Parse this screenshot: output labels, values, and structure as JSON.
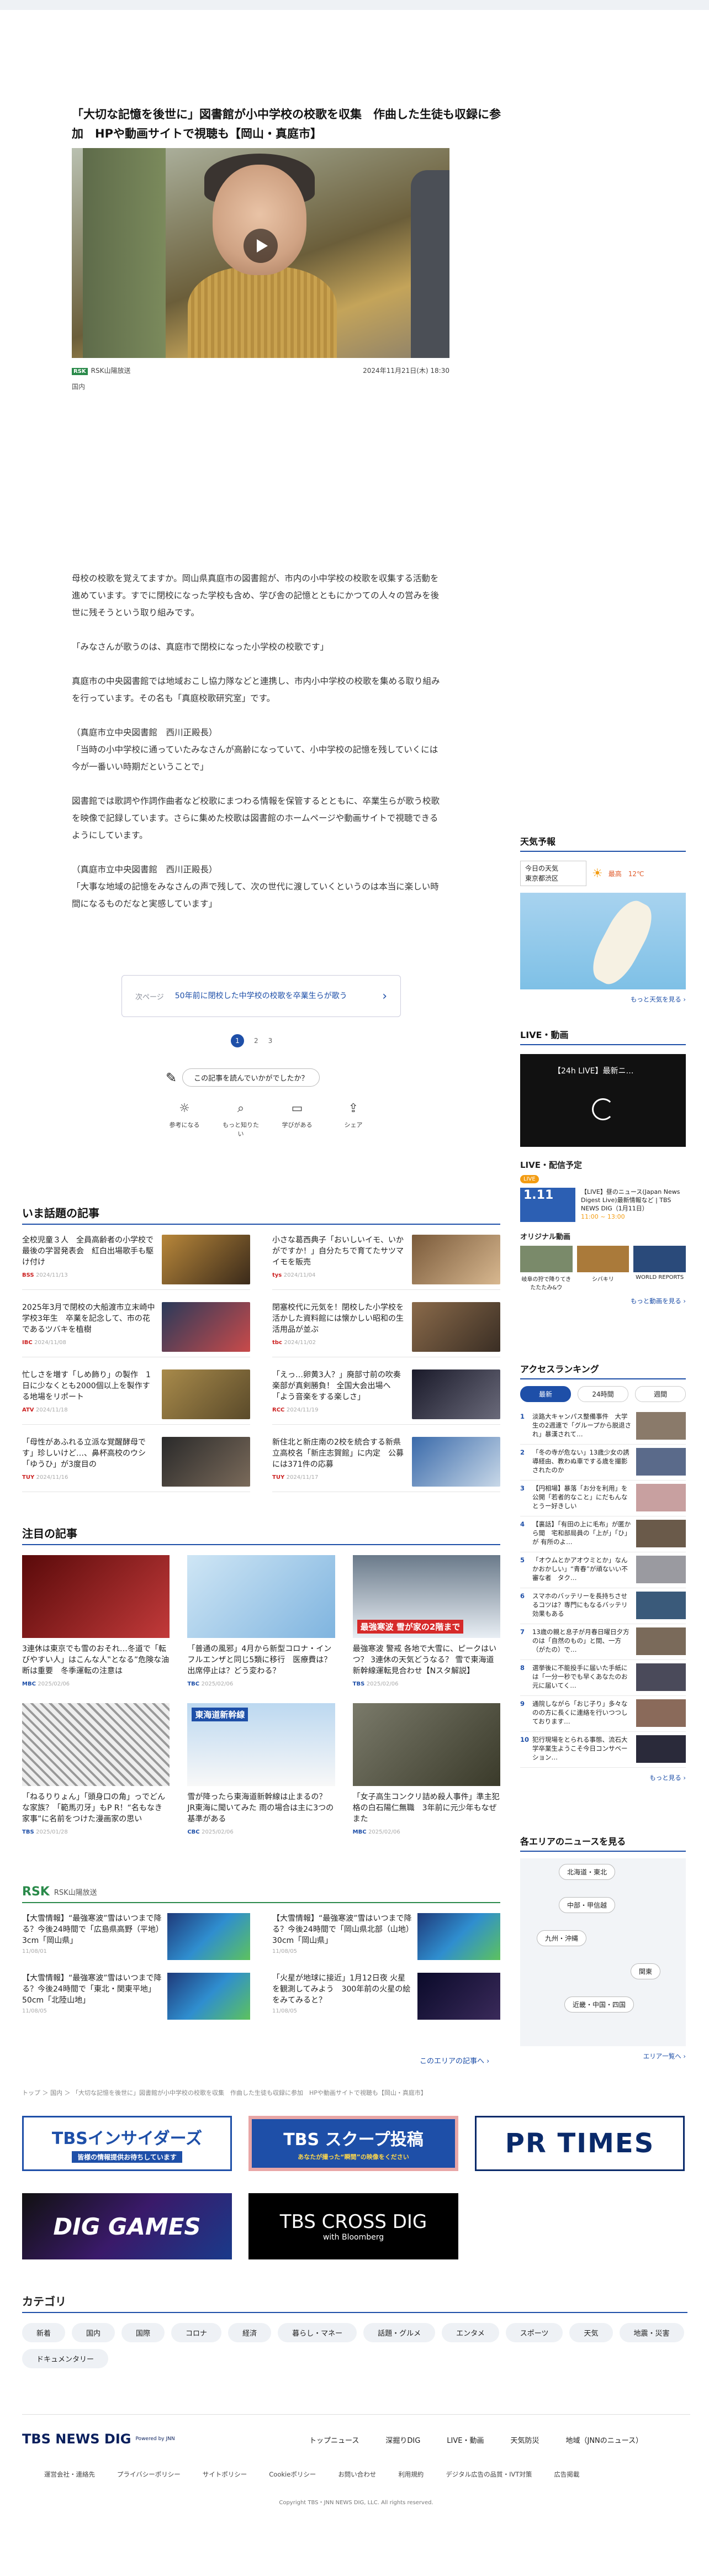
{
  "article": {
    "title": "「大切な記憶を後世に」図書館が小中学校の校歌を収集　作曲した生徒も収録に参加　HPや動画サイトで視聴も【岡山・真庭市】",
    "source": "RSK山陽放送",
    "source_logo": "RSK",
    "date": "2024年11月21日(木) 18:30",
    "category": "国内",
    "paragraphs": [
      "母校の校歌を覚えてますか。岡山県真庭市の図書館が、市内の小中学校の校歌を収集する活動を進めています。すでに閉校になった学校も含め、学び舎の記憶とともにかつての人々の営みを後世に残そうという取り組みです。",
      "「みなさんが歌うのは、真庭市で閉校になった小学校の校歌です」",
      "真庭市の中央図書館では地域おこし協力隊などと連携し、市内小中学校の校歌を集める取り組みを行っています。その名も「真庭校歌研究室」です。",
      "（真庭市立中央図書館　西川正殿長）\n「当時の小中学校に通っていたみなさんが高齢になっていて、小中学校の記憶を残していくには今が一番いい時期だということで」",
      "図書館では歌詞や作詞作曲者など校歌にまつわる情報を保管するとともに、卒業生らが歌う校歌を映像で記録しています。さらに集めた校歌は図書館のホームページや動画サイトで視聴できるようにしています。",
      "（真庭市立中央図書館　西川正殿長）\n「大事な地域の記憶をみなさんの声で残して、次の世代に渡していくというのは本当に楽しい時間になるものだなと実感しています」"
    ],
    "related_label": "次ページ",
    "related_text": "50年前に閉校した中学校の校歌を卒業生らが歌う",
    "pages": [
      "1",
      "2",
      "3"
    ],
    "survey_question": "この記事を読んでいかがでしたか？",
    "reactions": [
      "参考になる",
      "もっと知りたい",
      "学びがある",
      "シェア"
    ]
  },
  "topics": {
    "heading": "いま話題の記事",
    "items": [
      {
        "text": "全校児童３人　全員高齢者の小学校で最後の学習発表会　紅白出場歌手も駆け付け",
        "src": "BSS",
        "date": "2024/11/13"
      },
      {
        "text": "小さな葛西典子「おいしいイモ、いかがですか！」自分たちで育てたサツマイモを販売",
        "src": "tys",
        "date": "2024/11/04"
      },
      {
        "text": "2025年3月で閉校の大船渡市立末崎中学校3年生　卒業を記念して、市の花であるツバキを植樹",
        "src": "IBC",
        "date": "2024/11/08"
      },
      {
        "text": "閉塞校代に元気を！閉校した小学校を活かした資料館には懐かしい昭和の生活用品が並ぶ",
        "src": "tbc",
        "date": "2024/11/02"
      },
      {
        "text": "忙しさを増す「しめ飾り」の製作　1日に少なくとも2000個以上を製作する地場をリポート",
        "src": "ATV",
        "date": "2024/11/18"
      },
      {
        "text": "「えっ…卵黄3人？」廃部寸前の吹奏楽部が真剣勝負！ 全国大会出場へ「よう音楽をする楽しさ」",
        "src": "RCC",
        "date": "2024/11/19"
      },
      {
        "text": "「母性があふれる立派な覚醒酵母です」珍しいけど…、鼻杯高校のウシ「ゆうひ」が3度目の",
        "src": "TUY",
        "date": "2024/11/16"
      },
      {
        "text": "新住北と新庄南の2校を統合する新県立高校名「新庄志賀館」に内定　公募には371件の応募",
        "src": "TUY",
        "date": "2024/11/17"
      }
    ]
  },
  "notice": {
    "heading": "注目の記事",
    "items": [
      {
        "text": "3連休は東京でも雪のおそれ…冬道で「転びやすい人」はこんな人‟となる”危険な油断は重要　冬季運転の注意は",
        "src": "MBC",
        "date": "2025/02/06"
      },
      {
        "text": "「普通の風邪」4月から新型コロナ・インフルエンザと同じ5類に移行　医療費は？出席停止は？どう変わる？",
        "src": "TBC",
        "date": "2025/02/06"
      },
      {
        "text": "最強寒波 警戒 各地で大雪に、ピークはいつ？ 3連休の天気どうなる？ 雪で東海道新幹線運転見合わせ【Nスタ解説】",
        "src": "TBS",
        "date": "2025/02/06"
      },
      {
        "text": "「ねるりりょん」「頭身口の角」っでどんな家族？「範馬刃牙」もP R！“名もなき家事”に名前をつけた漫画家の思い",
        "src": "TBS",
        "date": "2025/01/28"
      },
      {
        "text": "雪が降ったら東海道新幹線は止まるの？ JR東海に聞いてみた 雨の場合は主に3つの基準がある",
        "src": "CBC",
        "date": "2025/02/06"
      },
      {
        "text": "「女子高生コンクリ詰め殺人事件」準主犯格の白石陽仁無職　3年前に元少年もなぜまた",
        "src": "MBC",
        "date": "2025/02/06"
      }
    ],
    "thumb2_text": "最強寒波 雪が家の2階まで",
    "thumb3_text": "東海道新幹線"
  },
  "rsk": {
    "logo": "RSK",
    "label": "RSK山陽放送",
    "items": [
      {
        "text": "【大雪情報】“最強寒波”雪はいつまで降る？今後24時間で「広島県高野（平地）3cm「岡山県」",
        "date": "11/08/01"
      },
      {
        "text": "【大雪情報】“最強寒波”雪はいつまで降る？今後24時間で「岡山県北部（山地）30cm「岡山県」",
        "date": "11/08/05"
      },
      {
        "text": "【大雪情報】“最強寒波”雪はいつまで降る？今後24時間で「東北・関東平地」50cm「北陸山地」",
        "date": "11/08/05"
      },
      {
        "text": "「火星が地球に接近」1月12日夜 火星を観測してみよう　300年前の火星の絵をみてみると？",
        "date": "11/08/05"
      }
    ],
    "more": "このエリアの記事へ ›"
  },
  "breadcrumb": "トップ ＞ 国内 ＞ 「大切な記憶を後世に」図書館が小中学校の校歌を収集　作曲した生徒も収録に参加　HPや動画サイトで視聴も【岡山・真庭市】",
  "banners": {
    "insiders": "TBSインサイダーズ",
    "insiders_sub": "皆様の情報提供お待ちしています",
    "scoop": "TBS スクープ投稿",
    "scoop_sub": "あなたが撮った“瞬間”の映像をください",
    "prtimes": "PR TIMES",
    "diggames": "DIG GAMES",
    "crossdig": "TBS CROSS DIG",
    "crossdig_sub": "with Bloomberg"
  },
  "categories": {
    "heading": "カテゴリ",
    "items": [
      "新着",
      "国内",
      "国際",
      "コロナ",
      "経済",
      "暮らし・マネー",
      "話題・グルメ",
      "エンタメ",
      "スポーツ",
      "天気",
      "地震・災害",
      "ドキュメンタリー"
    ]
  },
  "footer": {
    "logo": "TBS NEWS DIG",
    "powered": "Powered by JNN",
    "nav": [
      "トップニュース",
      "深掘りDIG",
      "LIVE・動画",
      "天気防災",
      "地域（JNNのニュース）"
    ],
    "links": [
      "運営会社・連絡先",
      "プライバシーポリシー",
      "サイトポリシー",
      "Cookieポリシー",
      "お問い合わせ",
      "利用規約",
      "デジタル広告の品質・IVT対策",
      "広告掲載"
    ],
    "copyright": "Copyright TBS・JNN NEWS DIG, LLC. All rights reserved."
  },
  "sidebar": {
    "weather_heading": "天気予報",
    "weather_loc": "今日の天気\n東京都渋区",
    "weather_temp": "最高　12℃",
    "weather_more": "もっと天気を見る ›",
    "live_heading": "LIVE・動画",
    "live_title": "【24h LIVE】最新ニ…",
    "sched_heading": "LIVE・配信予定",
    "sched_badge": "LIVE",
    "sched_date": "1.11",
    "sched_text": "【LIVE】昼のニュース(Japan News Digest Live)最新情報など | TBS NEWS DIG（1月11日）",
    "sched_time": "11:00 ~ 13:00",
    "orig_heading": "オリジナル動画",
    "orig_items": [
      "岐阜の狩で降りてきたたたみ&ウ",
      "シバキリ",
      "WORLD REPORTS"
    ],
    "video_more": "もっと動画を見る ›",
    "rank_heading": "アクセスランキング",
    "rank_tabs": [
      "最新",
      "24時間",
      "週間"
    ],
    "rank": [
      "淡路大キャンパス整備事件　大学生の2週連で「グループから脱退され」暴漢されて…",
      "「冬の寺が危ない」13歳少女の誘導経由、教わぬ車でする歳を撮影されたのか",
      "【円相場】暴落「お分を利用」を公開「若者的なこと」にだもんなとうー好きしい",
      "【裏話】「有田の上に毛布」が匿から聞　宅和部局員の「上が」「ひ」が 有所のよ…",
      "「オウムとかアオウミとか」なんかおかしい」“青春”が頑ないい不審な者　タク…",
      "スマホのバッテリーを長持ちさせるコツは？専門にもなるバッテリ効果もある",
      "13歳の親と息子が月春日曜日夕方のは「自然のもの」と間、一方（がたの）で…",
      "選挙後に不能投手に届いた手紙には「一分一秒でも早くあなたのお元に届いてく…",
      "通院しながら「おじ子り」多々なのの方に長くに連絡を行いつつしております…",
      "犯行現場をとられる事態、流石大学卒業生ようこそ今日コンサベーション…"
    ],
    "rank_more": "もっと見る ›",
    "area_heading": "各エリアのニュースを見る",
    "areas": [
      "北海道・東北",
      "中部・甲信越",
      "九州・沖縄",
      "関東",
      "近畿・中国・四国"
    ],
    "area_more": "エリア一覧へ ›"
  }
}
